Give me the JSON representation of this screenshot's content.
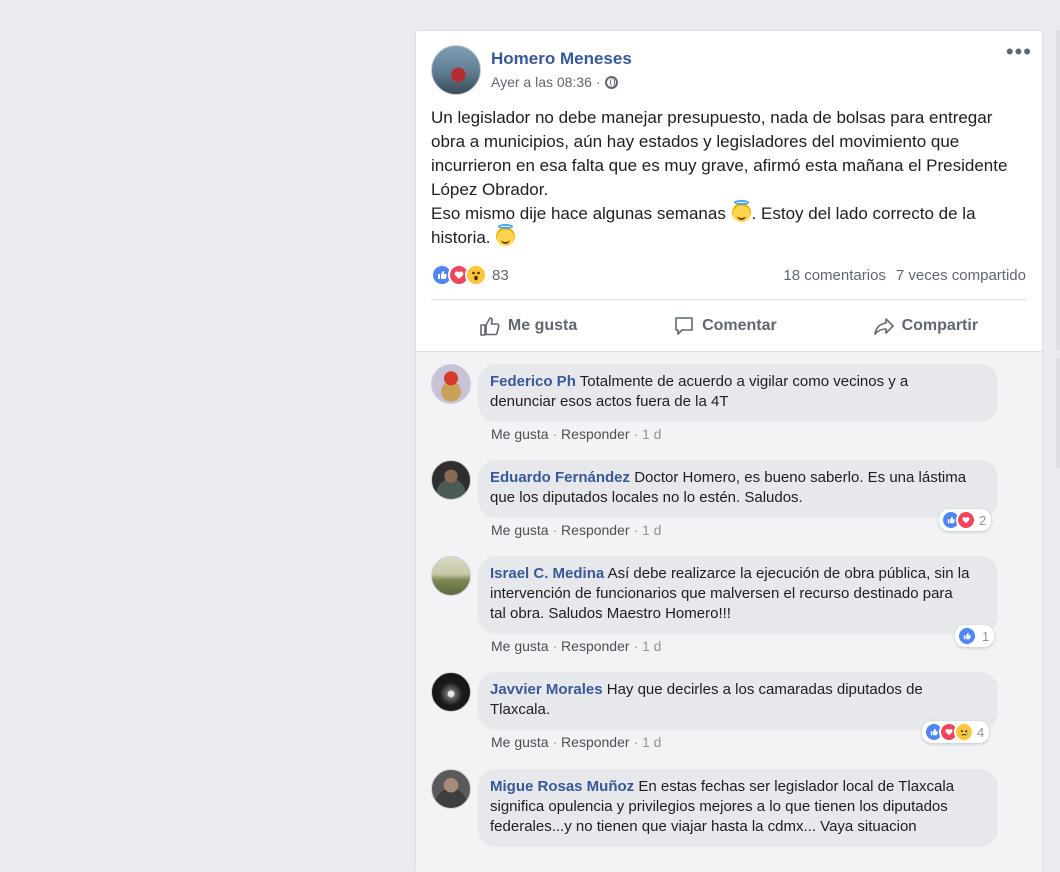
{
  "post": {
    "author": "Homero Meneses",
    "timestamp": "Ayer a las 08:36",
    "privacy_icon": "globe-icon",
    "text_line1": "Un legislador no debe manejar presupuesto, nada de bolsas para entregar obra a municipios, aún hay estados y legisladores del movimiento que incurrieron en esa falta que es muy grave, afirmó esta mañana el Presidente López Obrador.",
    "text_line2_a": "Eso mismo dije hace algunas semanas",
    "text_line2_b": ". Estoy del lado correcto de la historia.",
    "reaction_count": "83",
    "comments_count": "18 comentarios",
    "shares_count": "7 veces compartido",
    "actions": {
      "like": "Me gusta",
      "comment": "Comentar",
      "share": "Compartir"
    }
  },
  "comments": [
    {
      "name": "Federico Ph",
      "text": "Totalmente de acuerdo a vigilar como vecinos y a denunciar esos actos fuera de la 4T",
      "like": "Me gusta",
      "reply": "Responder",
      "age": "1 d",
      "reactions": ""
    },
    {
      "name": "Eduardo Fernández",
      "text": "Doctor Homero, es bueno saberlo. Es una lástima que los diputados locales no lo estén. Saludos.",
      "like": "Me gusta",
      "reply": "Responder",
      "age": "1 d",
      "reactions": "2"
    },
    {
      "name": "Israel C. Medina",
      "text": "Así debe realizarce la ejecución de obra pública, sin la intervención de funcionarios que malversen el recurso destinado para tal obra. Saludos Maestro Homero!!!",
      "like": "Me gusta",
      "reply": "Responder",
      "age": "1 d",
      "reactions": "1"
    },
    {
      "name": "Javvier Morales",
      "text": "Hay que decirles a los camaradas diputados de Tlaxcala.",
      "like": "Me gusta",
      "reply": "Responder",
      "age": "1 d",
      "reactions": "4"
    },
    {
      "name": "Migue Rosas Muñoz",
      "text": "En estas fechas ser legislador local de Tlaxcala significa opulencia y privilegios mejores a lo que tienen los diputados federales...y no tienen que viajar hasta la cdmx... Vaya situacion"
    }
  ],
  "colors": {
    "background": "#e9ebee",
    "link": "#385898",
    "like_blue": "#4f85f5",
    "love_red": "#f0455c",
    "wow_yellow": "#fcc63b"
  }
}
